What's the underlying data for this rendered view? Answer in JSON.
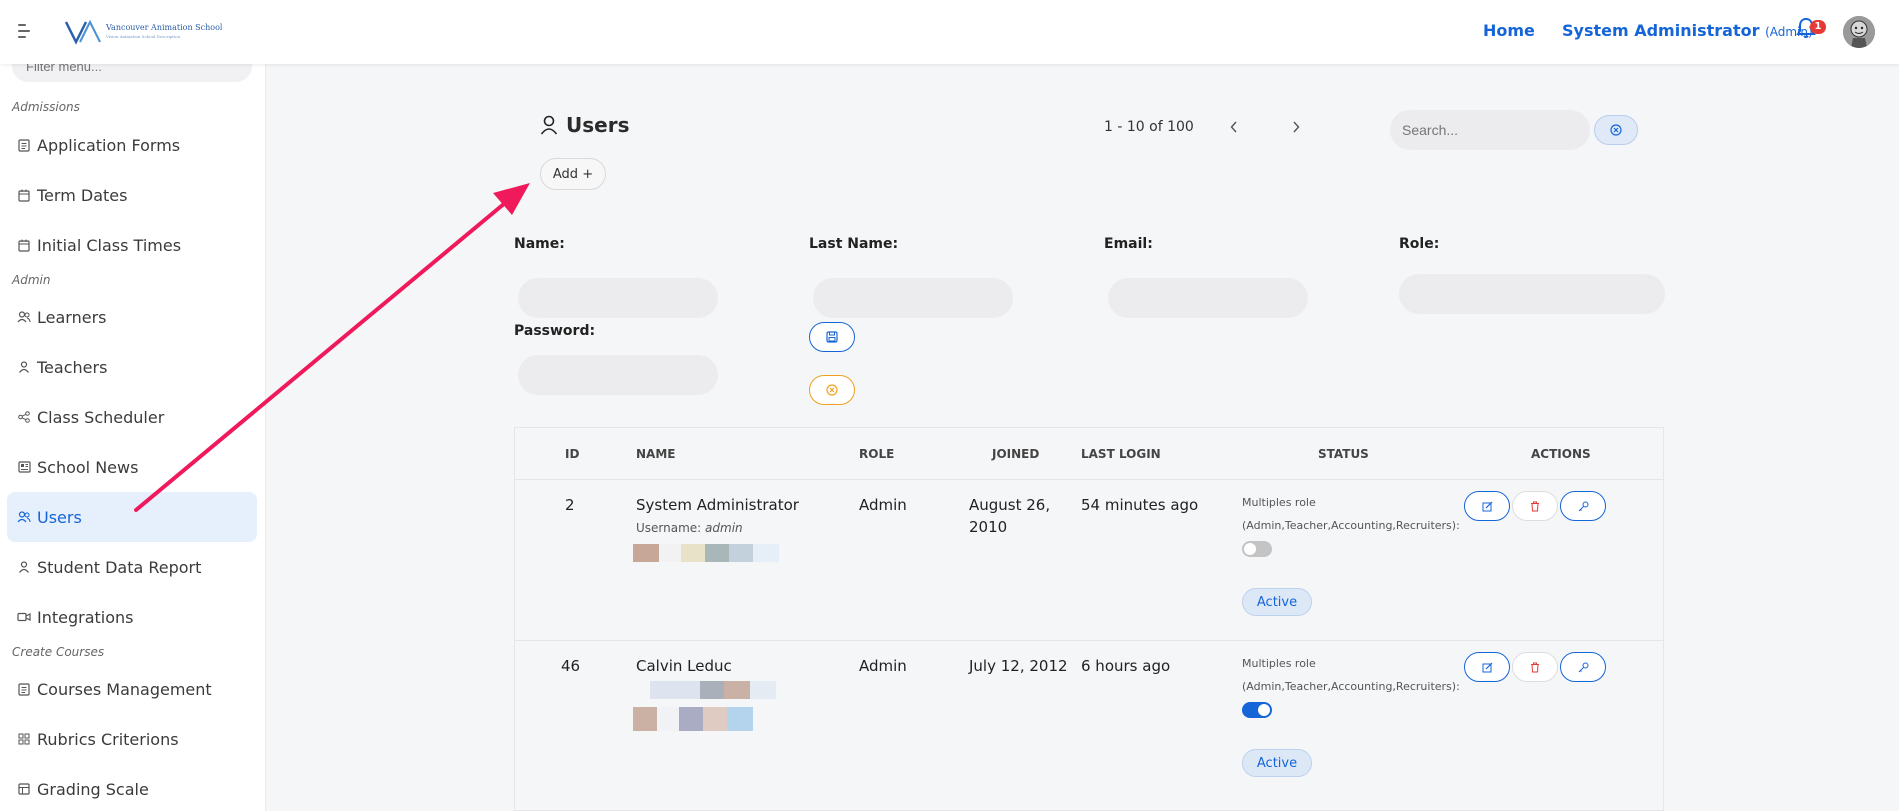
{
  "header": {
    "logo_text": "Vancouver Animation School",
    "logo_sub": "Vision Animation School Description",
    "home": "Home",
    "user_name": "System Administrator",
    "user_role": "(Admin)",
    "notifications_count": "1"
  },
  "sidebar": {
    "filter_placeholder": "Filter menu...",
    "sections": {
      "admissions": "Admissions",
      "admin": "Admin",
      "create_courses": "Create Courses"
    },
    "items": [
      {
        "label": "Application Forms",
        "icon": "document-icon"
      },
      {
        "label": "Term Dates",
        "icon": "calendar-icon"
      },
      {
        "label": "Initial Class Times",
        "icon": "calendar-icon"
      },
      {
        "label": "Learners",
        "icon": "users-icon"
      },
      {
        "label": "Teachers",
        "icon": "user-icon"
      },
      {
        "label": "Class Scheduler",
        "icon": "share-icon"
      },
      {
        "label": "School News",
        "icon": "newspaper-icon"
      },
      {
        "label": "Users",
        "icon": "users-icon",
        "active": true
      },
      {
        "label": "Student Data Report",
        "icon": "user-icon"
      },
      {
        "label": "Integrations",
        "icon": "video-icon"
      },
      {
        "label": "Courses Management",
        "icon": "document-icon"
      },
      {
        "label": "Rubrics Criterions",
        "icon": "grid-icon"
      },
      {
        "label": "Grading Scale",
        "icon": "table-icon"
      }
    ]
  },
  "main": {
    "title": "Users",
    "pagination": "1 - 10 of 100",
    "search_placeholder": "Search...",
    "add_label": "Add +",
    "form": {
      "name_label": "Name:",
      "last_name_label": "Last Name:",
      "email_label": "Email:",
      "role_label": "Role:",
      "password_label": "Password:"
    },
    "table": {
      "headers": [
        "ID",
        "NAME",
        "ROLE",
        "JOINED",
        "LAST LOGIN",
        "STATUS",
        "ACTIONS"
      ],
      "rows": [
        {
          "id": "2",
          "name": "System Administrator",
          "username_prefix": "Username:",
          "username": "admin",
          "role": "Admin",
          "joined": "August 26, 2010",
          "last_login": "54 minutes ago",
          "roles_text": "Multiples role (Admin,Teacher,Accounting,Recruiters):",
          "multi_role_on": false,
          "status": "Active"
        },
        {
          "id": "46",
          "name": "Calvin Leduc",
          "role": "Admin",
          "joined": "July 12, 2012",
          "last_login": "6 hours ago",
          "roles_text": "Multiples role (Admin,Teacher,Accounting,Recruiters):",
          "multi_role_on": true,
          "status": "Active"
        }
      ]
    }
  },
  "colors": {
    "accent": "#1565d8",
    "arrow": "#f0195b",
    "danger": "#e53935",
    "warning": "#f0a020"
  }
}
